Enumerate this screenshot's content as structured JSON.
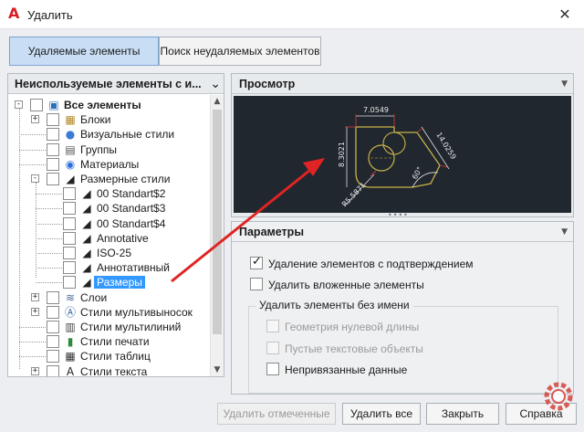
{
  "window": {
    "title": "Удалить",
    "app_icon": "autocad-logo-icon",
    "close_glyph": "✕"
  },
  "tabs": [
    {
      "label": "Удаляемые элементы",
      "active": true
    },
    {
      "label": "Поиск неудаляемых элементов",
      "active": false
    }
  ],
  "tree_panel": {
    "header": "Неиспользуемые элементы с и...",
    "items": [
      {
        "label": "Все элементы",
        "level": 0,
        "expander": "-",
        "icon": "all-items-icon",
        "bold": true
      },
      {
        "label": "Блоки",
        "level": 1,
        "expander": "+",
        "icon": "blocks-icon"
      },
      {
        "label": "Визуальные стили",
        "level": 1,
        "expander": "",
        "icon": "visual-styles-icon"
      },
      {
        "label": "Группы",
        "level": 1,
        "expander": "",
        "icon": "groups-icon"
      },
      {
        "label": "Материалы",
        "level": 1,
        "expander": "",
        "icon": "materials-icon"
      },
      {
        "label": "Размерные стили",
        "level": 1,
        "expander": "-",
        "icon": "dimension-style-icon"
      },
      {
        "label": "00 Standart$2",
        "level": 2,
        "expander": "",
        "icon": "dimension-style-icon"
      },
      {
        "label": "00 Standart$3",
        "level": 2,
        "expander": "",
        "icon": "dimension-style-icon"
      },
      {
        "label": "00 Standart$4",
        "level": 2,
        "expander": "",
        "icon": "dimension-style-icon"
      },
      {
        "label": "Annotative",
        "level": 2,
        "expander": "",
        "icon": "dimension-style-icon"
      },
      {
        "label": "ISO-25",
        "level": 2,
        "expander": "",
        "icon": "dimension-style-icon"
      },
      {
        "label": "Аннотативный",
        "level": 2,
        "expander": "",
        "icon": "dimension-style-icon"
      },
      {
        "label": "Размеры",
        "level": 2,
        "expander": "",
        "icon": "dimension-style-icon",
        "selected": true
      },
      {
        "label": "Слои",
        "level": 1,
        "expander": "+",
        "icon": "layers-icon"
      },
      {
        "label": "Стили мультивыносок",
        "level": 1,
        "expander": "+",
        "icon": "multileader-style-icon"
      },
      {
        "label": "Стили мультилиний",
        "level": 1,
        "expander": "",
        "icon": "multiline-style-icon"
      },
      {
        "label": "Стили печати",
        "level": 1,
        "expander": "",
        "icon": "plot-style-icon"
      },
      {
        "label": "Стили таблиц",
        "level": 1,
        "expander": "",
        "icon": "table-style-icon"
      },
      {
        "label": "Стили текста",
        "level": 1,
        "expander": "+",
        "icon": "text-style-icon"
      }
    ]
  },
  "preview": {
    "header": "Просмотр",
    "dimensions": {
      "top": "7.0549",
      "left": "8.3021",
      "right": "14.0259",
      "angle": "60°",
      "radius": "R5.5871"
    },
    "colors": {
      "background": "#21272e",
      "geometry": "#c9b24a",
      "dimensions": "#e0e0e0",
      "dim_marks": "#d43a3a"
    }
  },
  "params": {
    "header": "Параметры",
    "confirm": {
      "label": "Удаление элементов с подтверждением",
      "checked": true
    },
    "nested": {
      "label": "Удалить вложенные элементы",
      "checked": false
    },
    "unnamed_group": {
      "title": "Удалить элементы без имени",
      "zero_length": {
        "label": "Геометрия нулевой длины",
        "checked": false,
        "disabled": true
      },
      "empty_text": {
        "label": "Пустые текстовые объекты",
        "checked": false,
        "disabled": true
      },
      "orphaned": {
        "label": "Непривязанные данные",
        "checked": false,
        "disabled": false
      }
    }
  },
  "buttons": {
    "purge_checked": "Удалить отмеченные",
    "purge_all": "Удалить все",
    "close": "Закрыть",
    "help": "Справка"
  },
  "accent": {
    "selection": "#3399ff",
    "active_tab": "#c9def5",
    "arrow": "#e02424"
  }
}
